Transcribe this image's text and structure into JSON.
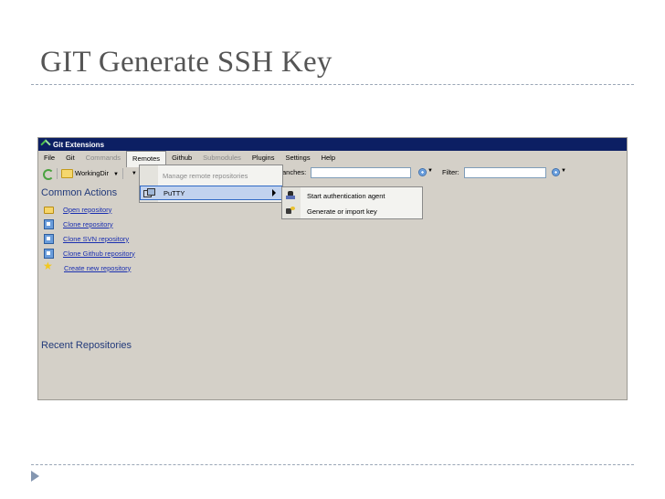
{
  "slide": {
    "title": "GIT Generate SSH Key"
  },
  "window": {
    "title": "Git Extensions"
  },
  "menubar": {
    "items": [
      "File",
      "Git",
      "Commands",
      "Remotes",
      "Github",
      "Submodules",
      "Plugins",
      "Settings",
      "Help"
    ]
  },
  "toolbar": {
    "working_dir": "WorkingDir",
    "branches_label": "anches:",
    "branch_value": "",
    "filter_label": "Filter:",
    "filter_value": ""
  },
  "remotes_menu": {
    "manage": "Manage remote repositories",
    "putty": "PuTTY"
  },
  "putty_submenu": {
    "start_agent": "Start authentication agent",
    "generate_key": "Generate or import key"
  },
  "common_actions": {
    "title": "Common Actions",
    "items": [
      {
        "label": "Open repository",
        "icon": "folder-icon"
      },
      {
        "label": "Clone repository",
        "icon": "clone-icon"
      },
      {
        "label": "Clone SVN repository",
        "icon": "clone-icon"
      },
      {
        "label": "Clone Github repository",
        "icon": "clone-icon"
      },
      {
        "label": "Create new repository",
        "icon": "star-icon"
      }
    ]
  },
  "recent": {
    "title": "Recent Repositories"
  }
}
